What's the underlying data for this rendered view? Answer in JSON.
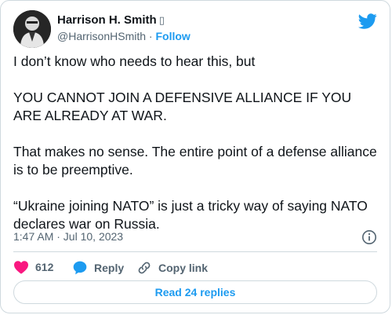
{
  "author": {
    "name": "Harrison H. Smith",
    "flag_glyph": "▯",
    "handle": "@HarrisonHSmith",
    "separator": "·",
    "follow_label": "Follow"
  },
  "tweet": {
    "paragraphs": [
      "I don’t know who needs to hear this, but",
      "YOU CANNOT JOIN A DEFENSIVE ALLIANCE IF YOU ARE ALREADY AT WAR.",
      "That makes no sense. The entire point of a defense alliance is to be preemptive.",
      "“Ukraine joining NATO” is just a tricky way of saying NATO declares war on Russia."
    ],
    "timestamp": "1:47 AM · Jul 10, 2023"
  },
  "actions": {
    "likes_count": "612",
    "reply_label": "Reply",
    "copy_link_label": "Copy link"
  },
  "read_replies_label": "Read 24 replies",
  "colors": {
    "accent": "#1d9bf0",
    "heart": "#f91880",
    "text": "#0f1419",
    "muted": "#536471",
    "border": "#cfd9de"
  },
  "icons": [
    "twitter-bird-icon",
    "info-icon",
    "heart-icon",
    "reply-bubble-icon",
    "link-icon"
  ]
}
